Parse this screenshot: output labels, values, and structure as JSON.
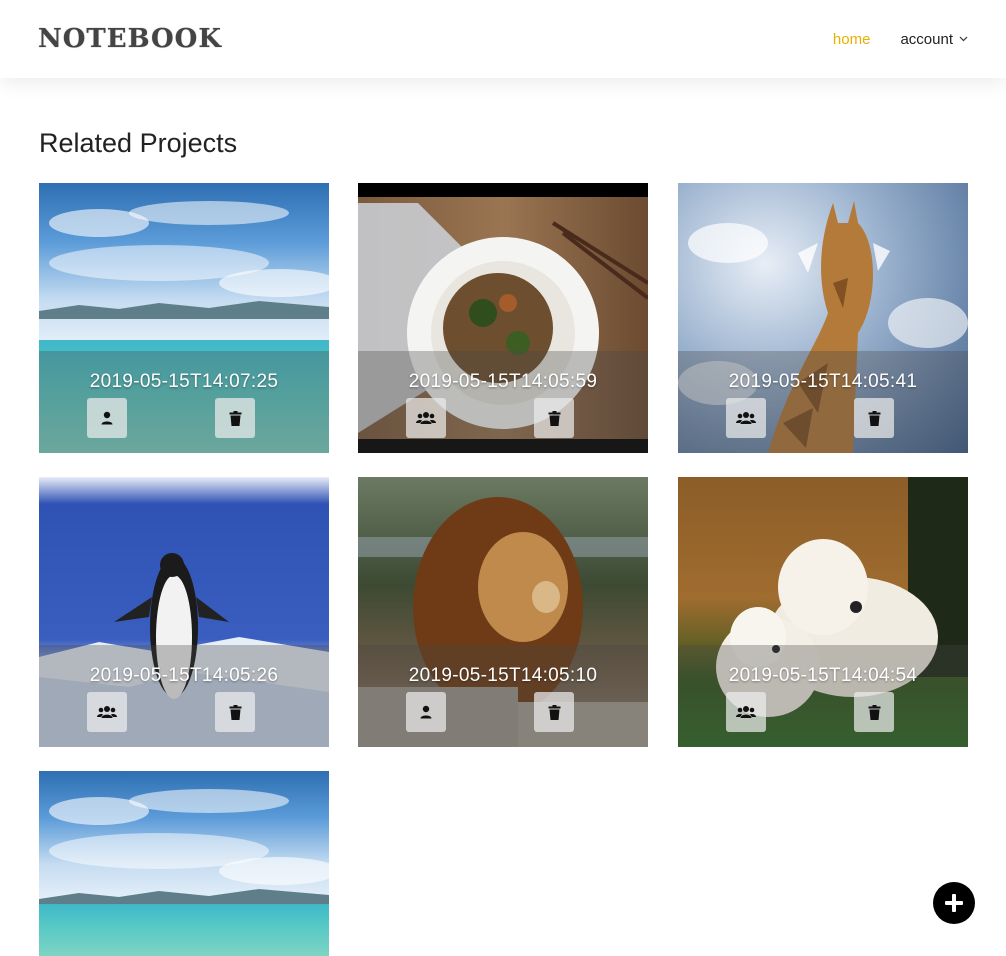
{
  "header": {
    "logo": "NOTEBOOK",
    "nav": {
      "home": "home",
      "account": "account"
    },
    "colors": {
      "active_nav": "#e8b100"
    }
  },
  "page": {
    "title": "Related Projects"
  },
  "projects": [
    {
      "timestamp": "2019-05-15T14:07:25",
      "image": "ocean-sky-photo",
      "share_icon": "user-icon",
      "delete_icon": "trash-icon"
    },
    {
      "timestamp": "2019-05-15T14:05:59",
      "image": "noodle-dish-photo",
      "share_icon": "users-icon",
      "delete_icon": "trash-icon"
    },
    {
      "timestamp": "2019-05-15T14:05:41",
      "image": "giraffe-photo",
      "share_icon": "users-icon",
      "delete_icon": "trash-icon"
    },
    {
      "timestamp": "2019-05-15T14:05:26",
      "image": "penguin-photo",
      "share_icon": "users-icon",
      "delete_icon": "trash-icon"
    },
    {
      "timestamp": "2019-05-15T14:05:10",
      "image": "lion-photo",
      "share_icon": "user-icon",
      "delete_icon": "trash-icon"
    },
    {
      "timestamp": "2019-05-15T14:04:54",
      "image": "dogs-photo",
      "share_icon": "users-icon",
      "delete_icon": "trash-icon"
    },
    {
      "timestamp": "",
      "image": "ocean-sky-photo",
      "share_icon": "",
      "delete_icon": ""
    }
  ],
  "fab": {
    "icon": "plus-icon"
  }
}
